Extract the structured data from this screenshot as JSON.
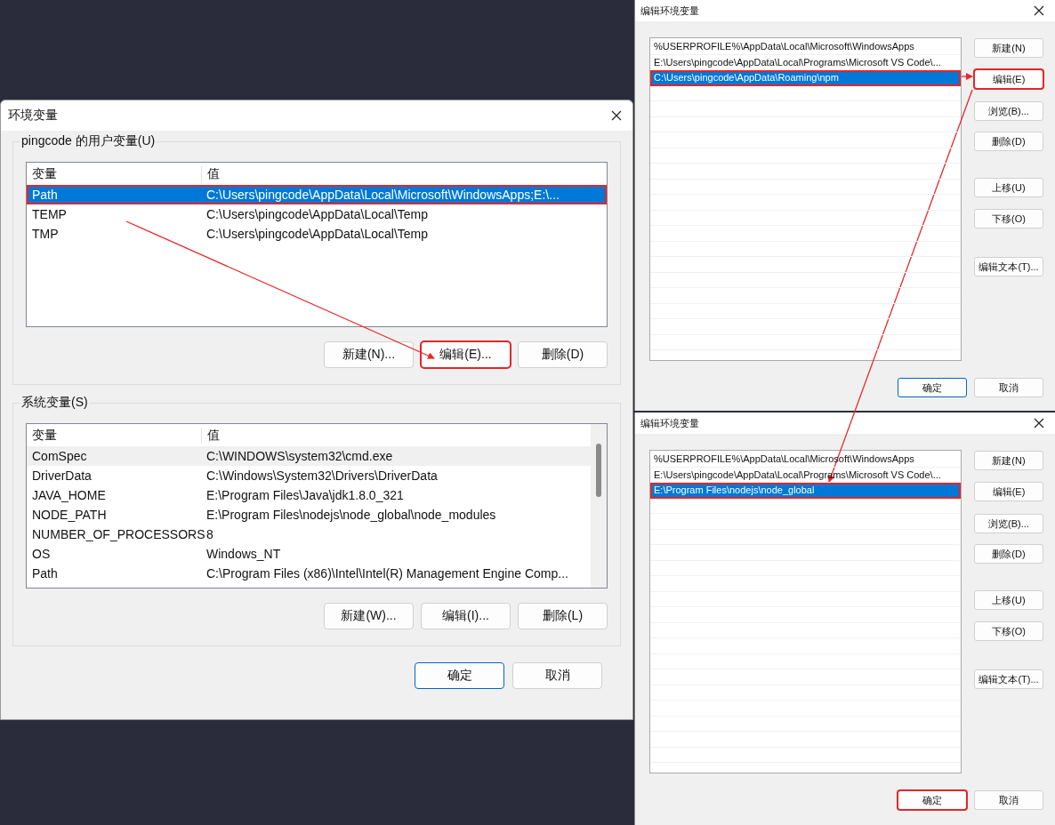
{
  "env_dialog": {
    "title": "环境变量",
    "user_vars": {
      "label": "pingcode 的用户变量(U)",
      "columns": [
        "变量",
        "值"
      ],
      "rows": [
        {
          "name": "Path",
          "value": "C:\\Users\\pingcode\\AppData\\Local\\Microsoft\\WindowsApps;E:\\...",
          "selected": true,
          "hovered": false,
          "highlighted": true
        },
        {
          "name": "TEMP",
          "value": "C:\\Users\\pingcode\\AppData\\Local\\Temp",
          "selected": false,
          "hovered": false,
          "highlighted": false
        },
        {
          "name": "TMP",
          "value": "C:\\Users\\pingcode\\AppData\\Local\\Temp",
          "selected": false,
          "hovered": false,
          "highlighted": false
        }
      ],
      "buttons": [
        {
          "label": "新建(N)...",
          "highlighted": false
        },
        {
          "label": "编辑(E)...",
          "highlighted": true
        },
        {
          "label": "删除(D)",
          "highlighted": false
        }
      ]
    },
    "system_vars": {
      "label": "系统变量(S)",
      "columns": [
        "变量",
        "值"
      ],
      "rows": [
        {
          "name": "ComSpec",
          "value": "C:\\WINDOWS\\system32\\cmd.exe",
          "selected": false,
          "hovered": true,
          "highlighted": false
        },
        {
          "name": "DriverData",
          "value": "C:\\Windows\\System32\\Drivers\\DriverData",
          "selected": false,
          "hovered": false,
          "highlighted": false
        },
        {
          "name": "JAVA_HOME",
          "value": "E:\\Program Files\\Java\\jdk1.8.0_321",
          "selected": false,
          "hovered": false,
          "highlighted": false
        },
        {
          "name": "NODE_PATH",
          "value": "E:\\Program Files\\nodejs\\node_global\\node_modules",
          "selected": false,
          "hovered": false,
          "highlighted": false
        },
        {
          "name": "NUMBER_OF_PROCESSORS",
          "value": "8",
          "selected": false,
          "hovered": false,
          "highlighted": false
        },
        {
          "name": "OS",
          "value": "Windows_NT",
          "selected": false,
          "hovered": false,
          "highlighted": false
        },
        {
          "name": "Path",
          "value": "C:\\Program Files (x86)\\Intel\\Intel(R) Management Engine Comp...",
          "selected": false,
          "hovered": false,
          "highlighted": false
        }
      ],
      "buttons": [
        {
          "label": "新建(W)...",
          "highlighted": false
        },
        {
          "label": "编辑(I)...",
          "highlighted": false
        },
        {
          "label": "删除(L)",
          "highlighted": false
        }
      ]
    },
    "footer_buttons": [
      {
        "label": "确定",
        "default": true,
        "highlighted": false
      },
      {
        "label": "取消",
        "default": false,
        "highlighted": false
      }
    ]
  },
  "edit_dialogs": [
    {
      "title": "编辑环境变量",
      "items": [
        {
          "text": "%USERPROFILE%\\AppData\\Local\\Microsoft\\WindowsApps",
          "selected": false,
          "highlighted": false
        },
        {
          "text": "E:\\Users\\pingcode\\AppData\\Local\\Programs\\Microsoft VS Code\\...",
          "selected": false,
          "highlighted": false
        },
        {
          "text": "C:\\Users\\pingcode\\AppData\\Roaming\\npm",
          "selected": true,
          "highlighted": true
        }
      ],
      "side_buttons": [
        {
          "label": "新建(N)",
          "highlighted": false
        },
        {
          "label": "编辑(E)",
          "highlighted": true
        },
        {
          "label": "浏览(B)...",
          "highlighted": false
        },
        {
          "label": "删除(D)",
          "highlighted": false
        },
        {
          "label": "上移(U)",
          "highlighted": false
        },
        {
          "label": "下移(O)",
          "highlighted": false
        },
        {
          "label": "编辑文本(T)...",
          "highlighted": false
        }
      ],
      "footer_buttons": [
        {
          "label": "确定",
          "default": true,
          "highlighted": false
        },
        {
          "label": "取消",
          "default": false,
          "highlighted": false
        }
      ]
    },
    {
      "title": "编辑环境变量",
      "items": [
        {
          "text": "%USERPROFILE%\\AppData\\Local\\Microsoft\\WindowsApps",
          "selected": false,
          "highlighted": false
        },
        {
          "text": "E:\\Users\\pingcode\\AppData\\Local\\Programs\\Microsoft VS Code\\...",
          "selected": false,
          "highlighted": false
        },
        {
          "text": "E:\\Program Files\\nodejs\\node_global",
          "selected": true,
          "highlighted": true
        }
      ],
      "side_buttons": [
        {
          "label": "新建(N)",
          "highlighted": false
        },
        {
          "label": "编辑(E)",
          "highlighted": false
        },
        {
          "label": "浏览(B)...",
          "highlighted": false
        },
        {
          "label": "删除(D)",
          "highlighted": false
        },
        {
          "label": "上移(U)",
          "highlighted": false
        },
        {
          "label": "下移(O)",
          "highlighted": false
        },
        {
          "label": "编辑文本(T)...",
          "highlighted": false
        }
      ],
      "footer_buttons": [
        {
          "label": "确定",
          "default": false,
          "highlighted": true
        },
        {
          "label": "取消",
          "default": false,
          "highlighted": false
        }
      ]
    }
  ]
}
